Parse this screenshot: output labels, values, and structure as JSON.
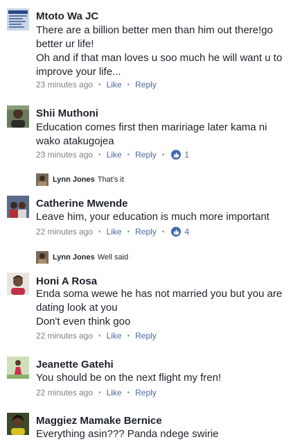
{
  "comments": [
    {
      "author": "Mtoto Wa JC",
      "lines": [
        "There are a billion better men than him out there!go",
        "better ur life!",
        "Oh and if that man loves u soo much he will want u to",
        "improve your life..."
      ],
      "time": "23 minutes ago",
      "like": "Like",
      "reply": "Reply"
    },
    {
      "author": "Shii Muthoni",
      "lines": [
        "Education comes first then maririage later kama ni",
        "wako atakugojea"
      ],
      "time": "23 minutes ago",
      "like": "Like",
      "reply": "Reply",
      "reactions": "1",
      "reply_preview": {
        "author": "Lynn Jones",
        "text": "That's it"
      }
    },
    {
      "author": "Catherine Mwende",
      "lines": [
        "Leave him, your education is much more important"
      ],
      "time": "22 minutes ago",
      "like": "Like",
      "reply": "Reply",
      "reactions": "4",
      "reply_preview": {
        "author": "Lynn Jones",
        "text": "Well said"
      }
    },
    {
      "author": "Honi A Rosa",
      "lines": [
        "Enda  soma wewe he has not married you but you are",
        "dating look at you",
        "Don't even think goo"
      ],
      "time": "22 minutes ago",
      "like": "Like",
      "reply": "Reply"
    },
    {
      "author": "Jeanette Gatehi",
      "lines": [
        "You should be on the next flight my fren!"
      ],
      "time": "22 minutes ago",
      "like": "Like",
      "reply": "Reply"
    },
    {
      "author": "Maggiez Mamake Bernice",
      "lines": [
        "Everything asin??? Panda ndege swirie"
      ]
    }
  ],
  "separator": "•",
  "colors": {
    "link": "#4b67a1",
    "meta": "#7f7f7f",
    "like_badge": "#4267b2"
  }
}
